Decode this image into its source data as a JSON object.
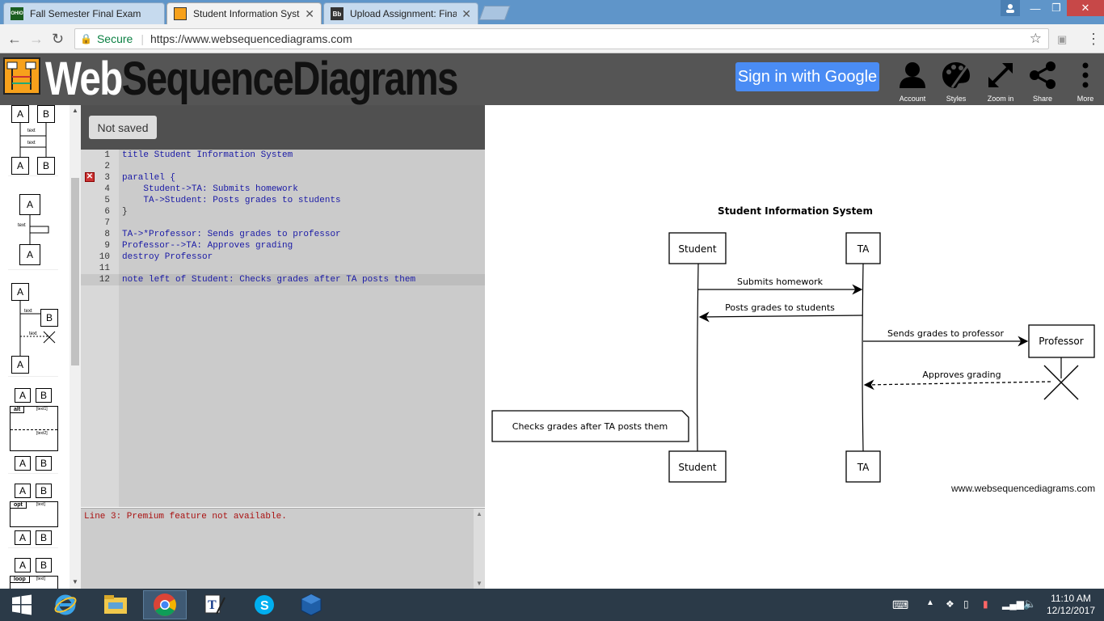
{
  "browser": {
    "tabs": [
      {
        "label": "Fall Semester Final Exam",
        "icon": "ohio-favicon-icon",
        "fav_text": "OHIO"
      },
      {
        "label": "Student Information Syst",
        "icon": "wsd-favicon-icon"
      },
      {
        "label": "Upload Assignment: Fina",
        "icon": "blackboard-favicon-icon",
        "fav_text": "Bb"
      }
    ],
    "secure_label": "Secure",
    "url": "https://www.websequencediagrams.com"
  },
  "header": {
    "logo_web": "Web",
    "logo_rest": "SequenceDiagrams",
    "signin_label": "Sign in with Google",
    "buttons": [
      {
        "label": "Account",
        "icon": "account-icon"
      },
      {
        "label": "Styles",
        "icon": "palette-icon"
      },
      {
        "label": "Zoom in",
        "icon": "zoom-icon"
      },
      {
        "label": "Share",
        "icon": "share-icon"
      },
      {
        "label": "More",
        "icon": "more-icon"
      }
    ]
  },
  "palette": {
    "box_a": "A",
    "box_b": "B",
    "msg": "text",
    "alt": "alt",
    "opt": "opt",
    "loop": "loop",
    "text1": "[text1]",
    "text2": "[text2]",
    "text_cond": "[text]"
  },
  "editor": {
    "status": "Not saved",
    "line_numbers": [
      "1",
      "2",
      "3",
      "4",
      "5",
      "6",
      "7",
      "8",
      "9",
      "10",
      "11",
      "12"
    ],
    "lines": [
      "title Student Information System",
      "",
      "parallel {",
      "    Student->TA: Submits homework",
      "    TA->Student: Posts grades to students",
      "}",
      "",
      "TA->*Professor: Sends grades to professor",
      "Professor-->TA: Approves grading",
      "destroy Professor",
      "",
      "note left of Student: Checks grades after TA posts them"
    ],
    "error": "Line 3: Premium feature not available."
  },
  "diagram": {
    "title": "Student Information System",
    "participants": [
      "Student",
      "TA",
      "Professor"
    ],
    "messages": [
      "Submits homework",
      "Posts grades to students",
      "Sends grades to professor",
      "Approves grading"
    ],
    "note": "Checks grades after TA posts them",
    "watermark": "www.websequencediagrams.com"
  },
  "taskbar": {
    "apps": [
      "start-icon",
      "ie-icon",
      "explorer-icon",
      "chrome-icon",
      "typora-icon",
      "skype-icon",
      "virtualbox-icon"
    ],
    "time": "11:10 AM",
    "date": "12/12/2017"
  }
}
